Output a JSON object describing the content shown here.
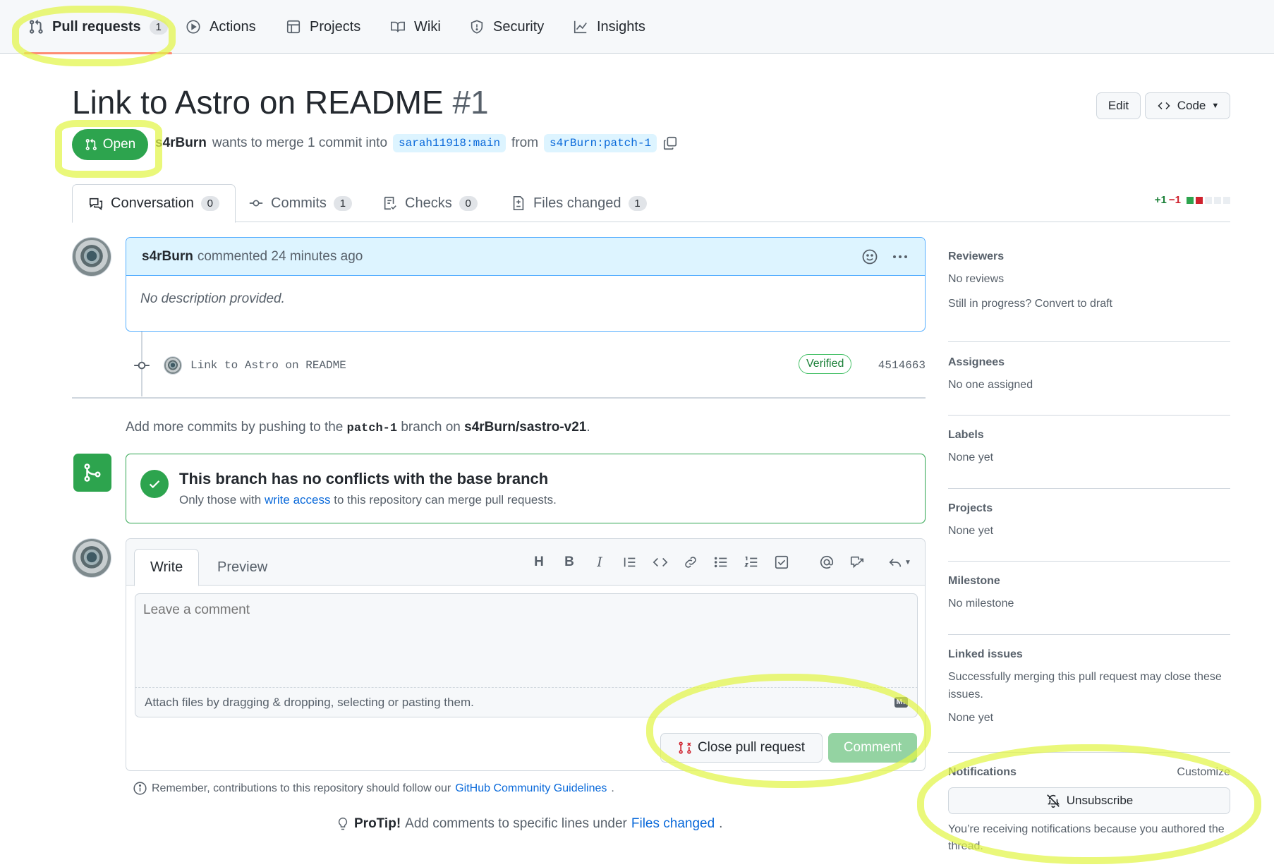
{
  "nav": {
    "items": [
      {
        "label": "Pull requests",
        "count": "1",
        "icon": "git-pull-request-icon"
      },
      {
        "label": "Actions",
        "icon": "play-icon"
      },
      {
        "label": "Projects",
        "icon": "table-icon"
      },
      {
        "label": "Wiki",
        "icon": "book-icon"
      },
      {
        "label": "Security",
        "icon": "shield-icon"
      },
      {
        "label": "Insights",
        "icon": "graph-icon"
      }
    ]
  },
  "header": {
    "title": "Link to Astro on README",
    "number": "#1",
    "edit_label": "Edit",
    "code_label": "Code",
    "state": "Open",
    "author": "s4rBurn",
    "merge_text": "wants to merge 1 commit into",
    "base_branch": "sarah11918:main",
    "from_text": "from",
    "head_branch": "s4rBurn:patch-1"
  },
  "tabs": [
    {
      "label": "Conversation",
      "count": "0"
    },
    {
      "label": "Commits",
      "count": "1"
    },
    {
      "label": "Checks",
      "count": "0"
    },
    {
      "label": "Files changed",
      "count": "1"
    }
  ],
  "diffstat": {
    "additions": "+1",
    "deletions": "−1",
    "colors": [
      "#2da44e",
      "#cf222e"
    ]
  },
  "comment": {
    "author": "s4rBurn",
    "meta": "commented 24 minutes ago",
    "body": "No description provided."
  },
  "commit": {
    "message": "Link to Astro on README",
    "verified": "Verified",
    "sha": "4514663"
  },
  "push_hint": {
    "prefix": "Add more commits by pushing to the",
    "branch": "patch-1",
    "middle": "branch on",
    "repo": "s4rBurn/sastro-v21",
    "suffix": "."
  },
  "merge_status": {
    "title": "This branch has no conflicts with the base branch",
    "prefix": "Only those with",
    "link": "write access",
    "suffix": "to this repository can merge pull requests."
  },
  "composer": {
    "write_tab": "Write",
    "preview_tab": "Preview",
    "placeholder": "Leave a comment",
    "attach_text": "Attach files by dragging & dropping, selecting or pasting them.",
    "close_label": "Close pull request",
    "comment_label": "Comment"
  },
  "guidelines": {
    "prefix": "Remember, contributions to this repository should follow our",
    "link": "GitHub Community Guidelines",
    "suffix": "."
  },
  "protip": {
    "label": "ProTip!",
    "prefix": "Add comments to specific lines under",
    "link": "Files changed",
    "suffix": "."
  },
  "sidebar": {
    "reviewers": {
      "title": "Reviewers",
      "value": "No reviews",
      "draft": "Still in progress? Convert to draft"
    },
    "assignees": {
      "title": "Assignees",
      "value": "No one assigned"
    },
    "labels": {
      "title": "Labels",
      "value": "None yet"
    },
    "projects": {
      "title": "Projects",
      "value": "None yet"
    },
    "milestone": {
      "title": "Milestone",
      "value": "No milestone"
    },
    "linked": {
      "title": "Linked issues",
      "desc": "Successfully merging this pull request may close these issues.",
      "value": "None yet"
    },
    "notifications": {
      "title": "Notifications",
      "customize": "Customize",
      "button": "Unsubscribe",
      "reason": "You’re receiving notifications because you authored the thread."
    }
  },
  "colors": {
    "accent": "#0969da",
    "success": "#2da44e",
    "highlight": "#e2f546"
  }
}
